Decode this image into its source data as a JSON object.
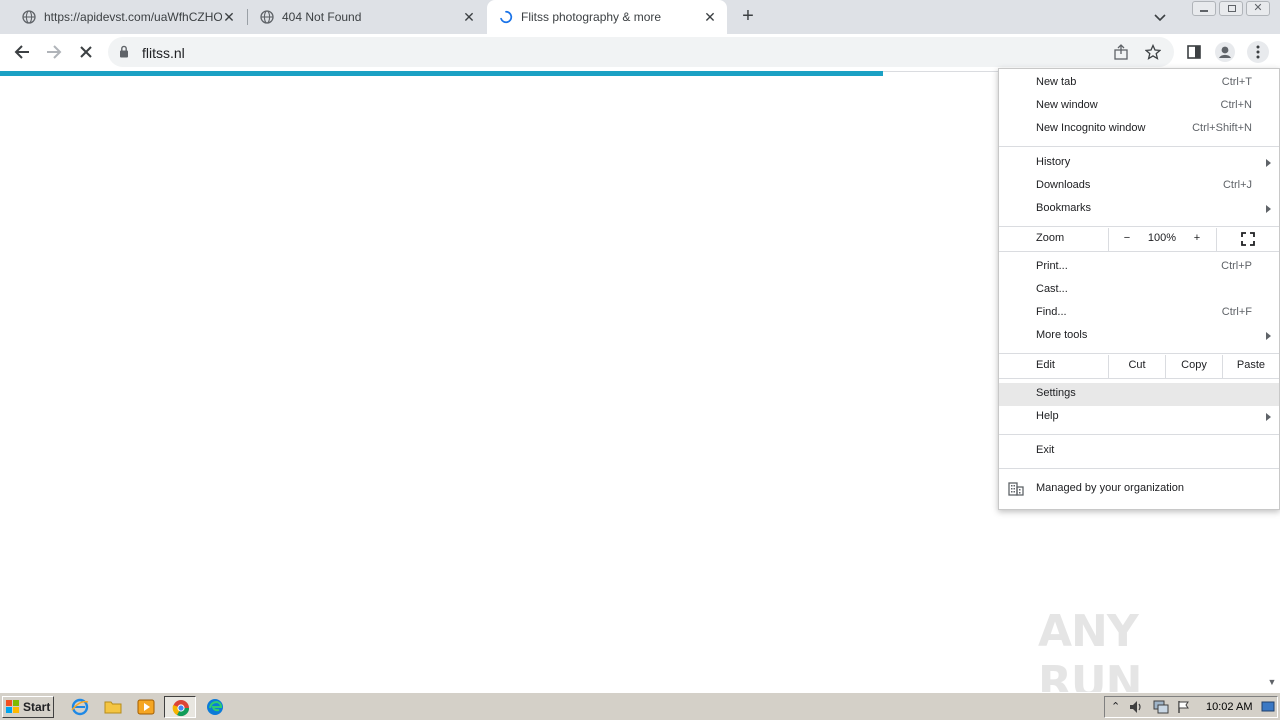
{
  "tabs": [
    {
      "title": "https://apidevst.com/uaWfhCZHOIP",
      "favicon": "globe-icon",
      "active": false
    },
    {
      "title": "404 Not Found",
      "favicon": "globe-icon",
      "active": false
    },
    {
      "title": "Flitss photography & more",
      "favicon": "loading-spinner-icon",
      "active": true
    }
  ],
  "toolbar": {
    "url": "flitss.nl"
  },
  "loading_progress": 0.69,
  "menu": {
    "new_tab": {
      "label": "New tab",
      "shortcut": "Ctrl+T"
    },
    "new_window": {
      "label": "New window",
      "shortcut": "Ctrl+N"
    },
    "new_incognito": {
      "label": "New Incognito window",
      "shortcut": "Ctrl+Shift+N"
    },
    "history": {
      "label": "History"
    },
    "downloads": {
      "label": "Downloads",
      "shortcut": "Ctrl+J"
    },
    "bookmarks": {
      "label": "Bookmarks"
    },
    "zoom": {
      "label": "Zoom",
      "minus": "−",
      "value": "100%",
      "plus": "+"
    },
    "print": {
      "label": "Print...",
      "shortcut": "Ctrl+P"
    },
    "cast": {
      "label": "Cast..."
    },
    "find": {
      "label": "Find...",
      "shortcut": "Ctrl+F"
    },
    "more_tools": {
      "label": "More tools"
    },
    "edit": {
      "label": "Edit",
      "cut": "Cut",
      "copy": "Copy",
      "paste": "Paste"
    },
    "settings": {
      "label": "Settings"
    },
    "help": {
      "label": "Help"
    },
    "exit": {
      "label": "Exit"
    },
    "managed": {
      "label": "Managed by your organization"
    }
  },
  "watermark": "ANY RUN",
  "taskbar": {
    "start_label": "Start",
    "clock": "10:02 AM"
  }
}
